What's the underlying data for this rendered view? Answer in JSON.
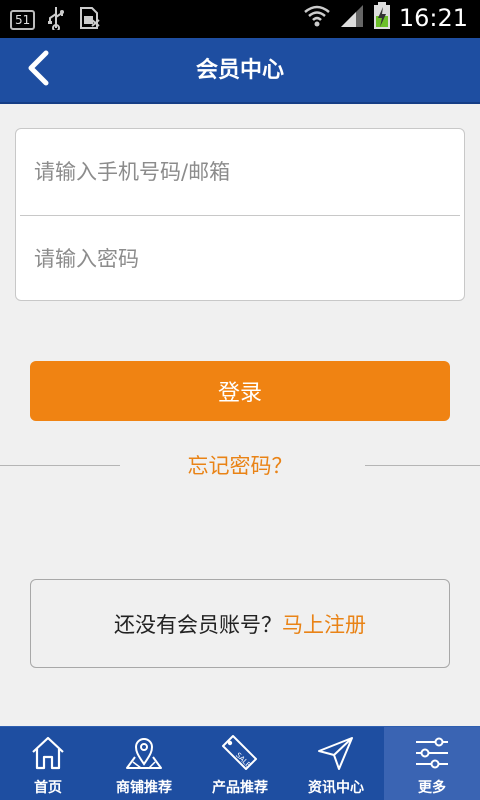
{
  "status_bar": {
    "badge": "51",
    "time": "16:21",
    "icons": [
      "usb-icon",
      "sim-icon",
      "wifi-icon",
      "signal-icon",
      "battery-charging-icon"
    ]
  },
  "header": {
    "title": "会员中心",
    "back_icon": "chevron-left-icon"
  },
  "form": {
    "account_placeholder": "请输入手机号码/邮箱",
    "account_value": "",
    "password_placeholder": "请输入密码",
    "password_value": "",
    "login_label": "登录",
    "forgot_label": "忘记密码？"
  },
  "register": {
    "prompt": "还没有会员账号？",
    "link_label": "马上注册"
  },
  "bottom_nav": {
    "items": [
      {
        "label": "首页",
        "icon": "home-icon"
      },
      {
        "label": "商铺推荐",
        "icon": "map-pin-icon"
      },
      {
        "label": "产品推荐",
        "icon": "sale-tag-icon"
      },
      {
        "label": "资讯中心",
        "icon": "paper-plane-icon"
      },
      {
        "label": "更多",
        "icon": "sliders-icon"
      }
    ],
    "active_index": 4
  },
  "colors": {
    "header_bg": "#1e4ea1",
    "accent_orange": "#f08312",
    "page_bg": "#f0f0f0"
  }
}
